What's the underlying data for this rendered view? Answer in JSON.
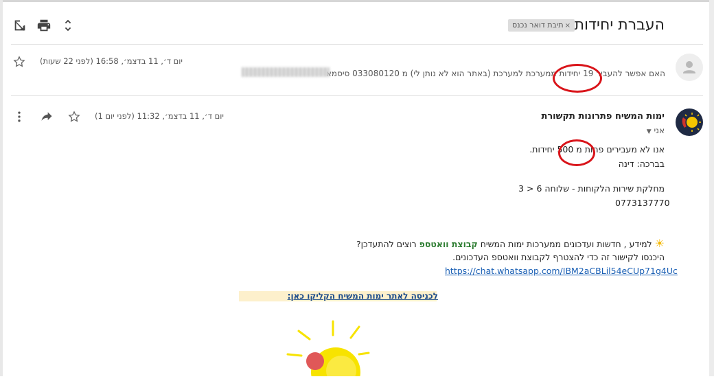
{
  "toolbar": {
    "popout_icon": "popout-icon",
    "print_icon": "print-icon",
    "expand_icon": "expand-collapse-icon"
  },
  "subject": "העברת יחידות",
  "label": {
    "text": "תיבת דואר נכנס",
    "remove": "×"
  },
  "collapsed_message": {
    "date": "יום ד׳, 11 בדצמ׳, 16:58 (לפני 22 שעות)",
    "snippet": "האם אפשר להעביר 19 יחידות ממערכת למערכת (באתר הוא לא נותן לי) מ 033080120 סיסמא"
  },
  "message": {
    "sender": "ימות המשיח פתרונות תקשורת",
    "to": "אני",
    "date": "יום ד׳, 11 בדצמ׳, 11:32 (לפני יום 1)",
    "line1": "אנו לא מעבירים פחות מ 500 יחידות.",
    "line2": "בברכה: דינה",
    "line3": "מחלקת שירות הלקוחות - שלוחה 6 < 3",
    "phone": "0773137770",
    "promo_a": "רוצים להתעדכן?",
    "promo_green": "קבוצת וואטספ",
    "promo_b": "למידע , חדשות ועדכונים ממערכות ימות המשיח",
    "join_text": "היכנסו לקישור זה כדי להצטרף לקבוצת וואטספ העדכונים.",
    "whatsapp_link": "https://chat.whatsapp.com/IBM2aCBLil54eCUp71g4Uc",
    "site_link": "לכניסה לאתר ימות המשיח הקליקו כאן:"
  },
  "colors": {
    "annotation": "#d9141a",
    "link": "#1a5fb4",
    "promo_green": "#2e7d32",
    "banner": "#fdf0cc"
  }
}
